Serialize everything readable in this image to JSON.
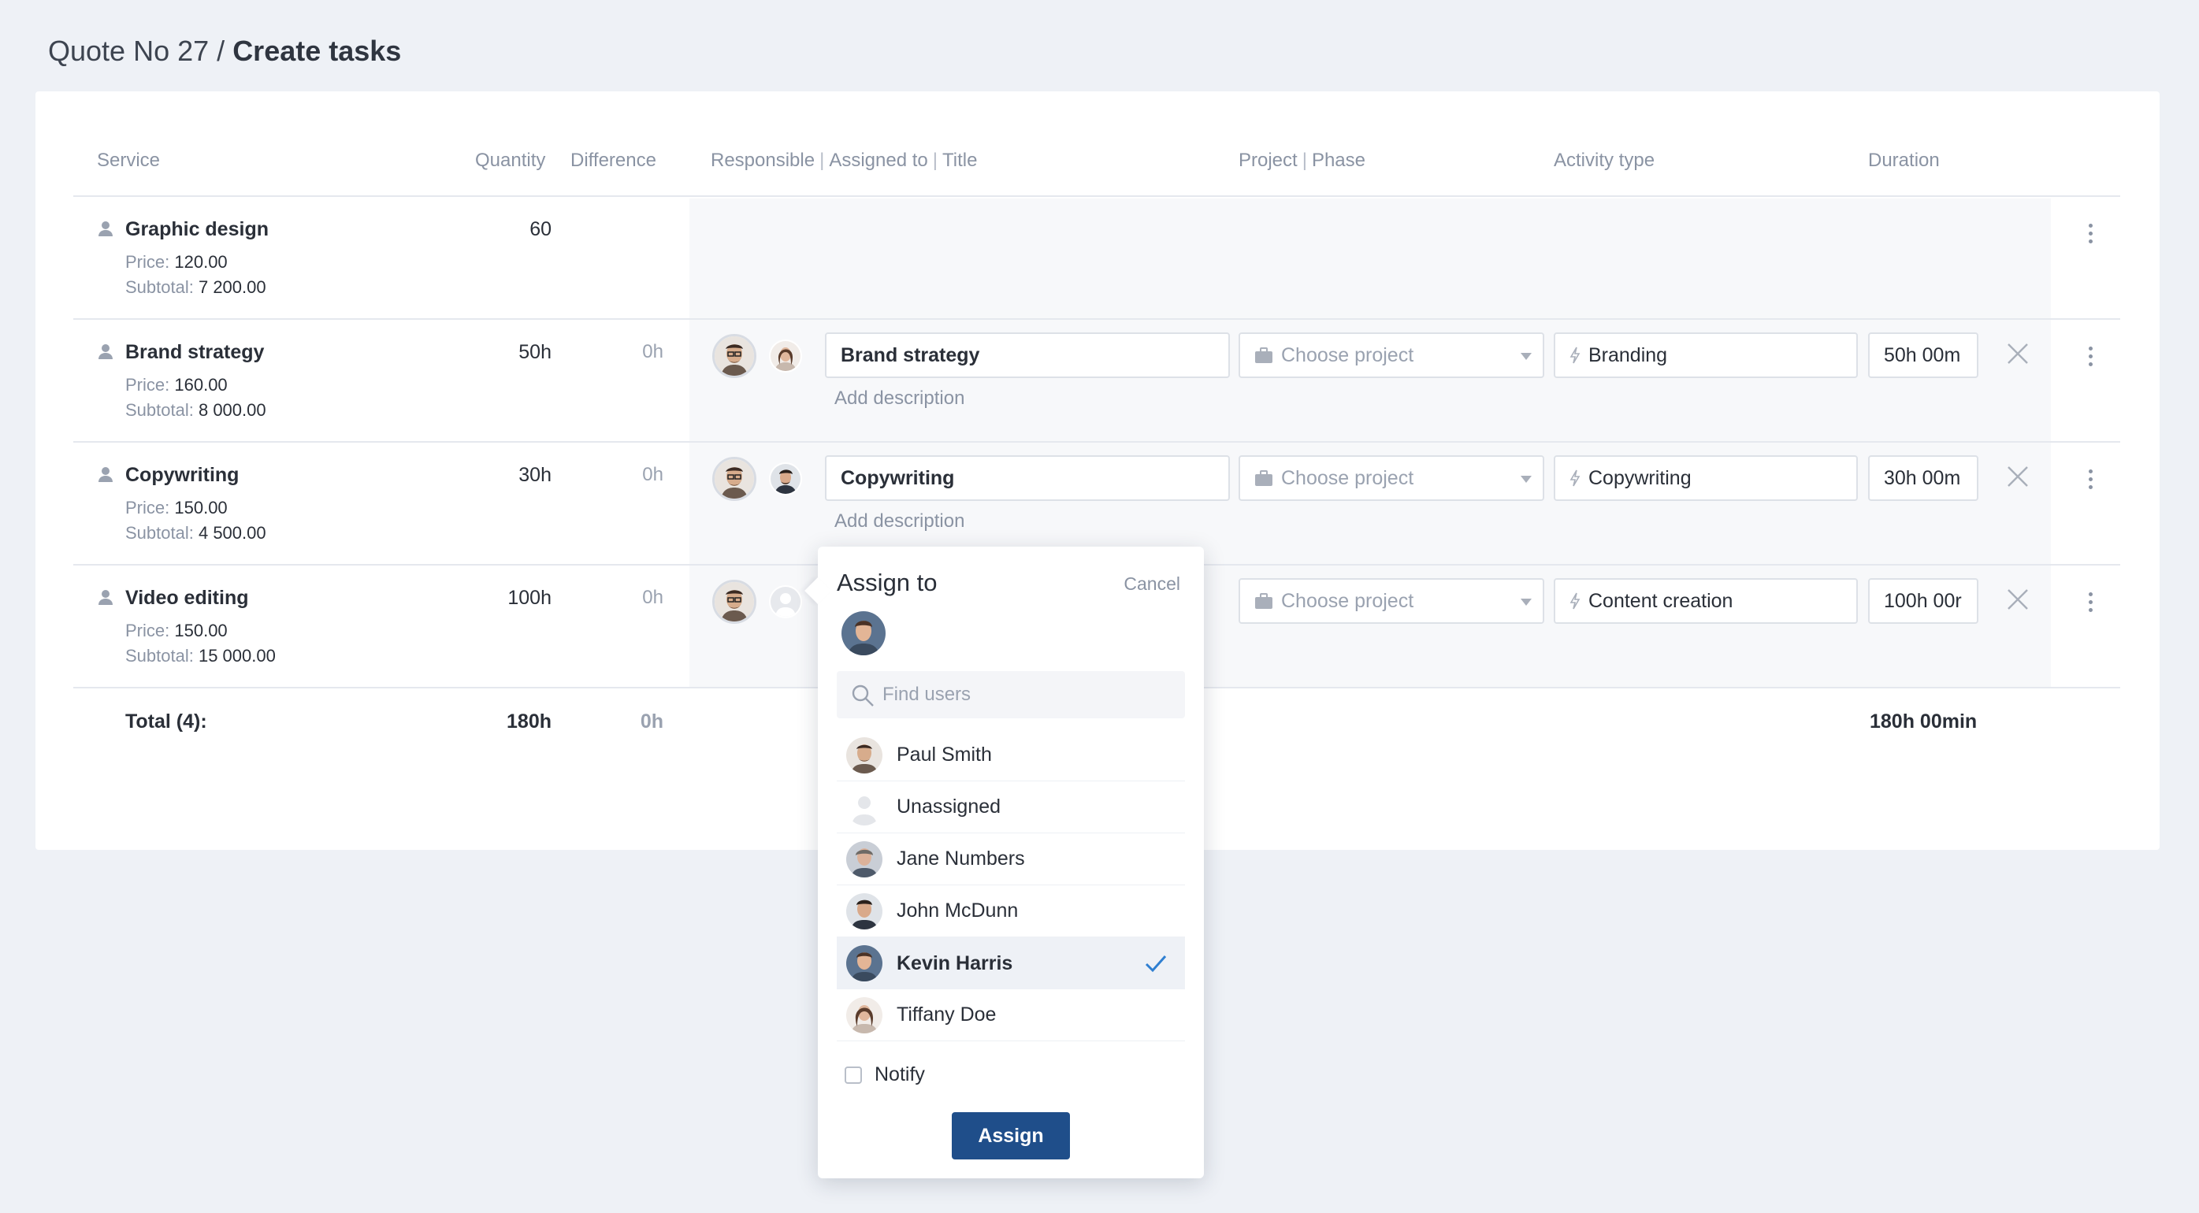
{
  "breadcrumb": {
    "parent": "Quote No 27",
    "separator": "/",
    "current": "Create tasks"
  },
  "columns": {
    "service": "Service",
    "quantity": "Quantity",
    "difference": "Difference",
    "responsible": "Responsible",
    "assigned_to": "Assigned to",
    "title": "Title",
    "project": "Project",
    "phase": "Phase",
    "activity_type": "Activity type",
    "duration": "Duration",
    "header_sep": "|"
  },
  "labels": {
    "price": "Price:",
    "subtotal": "Subtotal:",
    "add_description": "Add description",
    "choose_project": "Choose project"
  },
  "rows": [
    {
      "name": "Graphic design",
      "quantity": "60",
      "difference": "",
      "price": "120.00",
      "subtotal": "7 200.00"
    },
    {
      "name": "Brand strategy",
      "quantity": "50h",
      "difference": "0h",
      "price": "160.00",
      "subtotal": "8 000.00",
      "title": "Brand strategy",
      "activity": "Branding",
      "duration": "50h 00m"
    },
    {
      "name": "Copywriting",
      "quantity": "30h",
      "difference": "0h",
      "price": "150.00",
      "subtotal": "4 500.00",
      "title": "Copywriting",
      "activity": "Copywriting",
      "duration": "30h 00m"
    },
    {
      "name": "Video editing",
      "quantity": "100h",
      "difference": "0h",
      "price": "150.00",
      "subtotal": "15 000.00",
      "title": "",
      "activity": "Content creation",
      "duration": "100h 00r"
    }
  ],
  "totals": {
    "label": "Total (4):",
    "quantity": "180h",
    "difference": "0h",
    "duration": "180h 00min"
  },
  "popup": {
    "title": "Assign to",
    "cancel": "Cancel",
    "search_placeholder": "Find users",
    "users": [
      {
        "name": "Paul Smith",
        "selected": false
      },
      {
        "name": "Unassigned",
        "selected": false
      },
      {
        "name": "Jane Numbers",
        "selected": false
      },
      {
        "name": "John McDunn",
        "selected": false
      },
      {
        "name": "Kevin Harris",
        "selected": true
      },
      {
        "name": "Tiffany Doe",
        "selected": false
      }
    ],
    "notify_label": "Notify",
    "assign_label": "Assign"
  },
  "colors": {
    "accent": "#1f4e8a",
    "check": "#2f7fd1",
    "row_tint": "#f7f8fa",
    "muted": "#8a93a3"
  },
  "icons": [
    "user-icon",
    "briefcase-icon",
    "bolt-icon",
    "close-icon",
    "kebab-icon",
    "search-icon",
    "check-icon",
    "caret-down-icon"
  ]
}
